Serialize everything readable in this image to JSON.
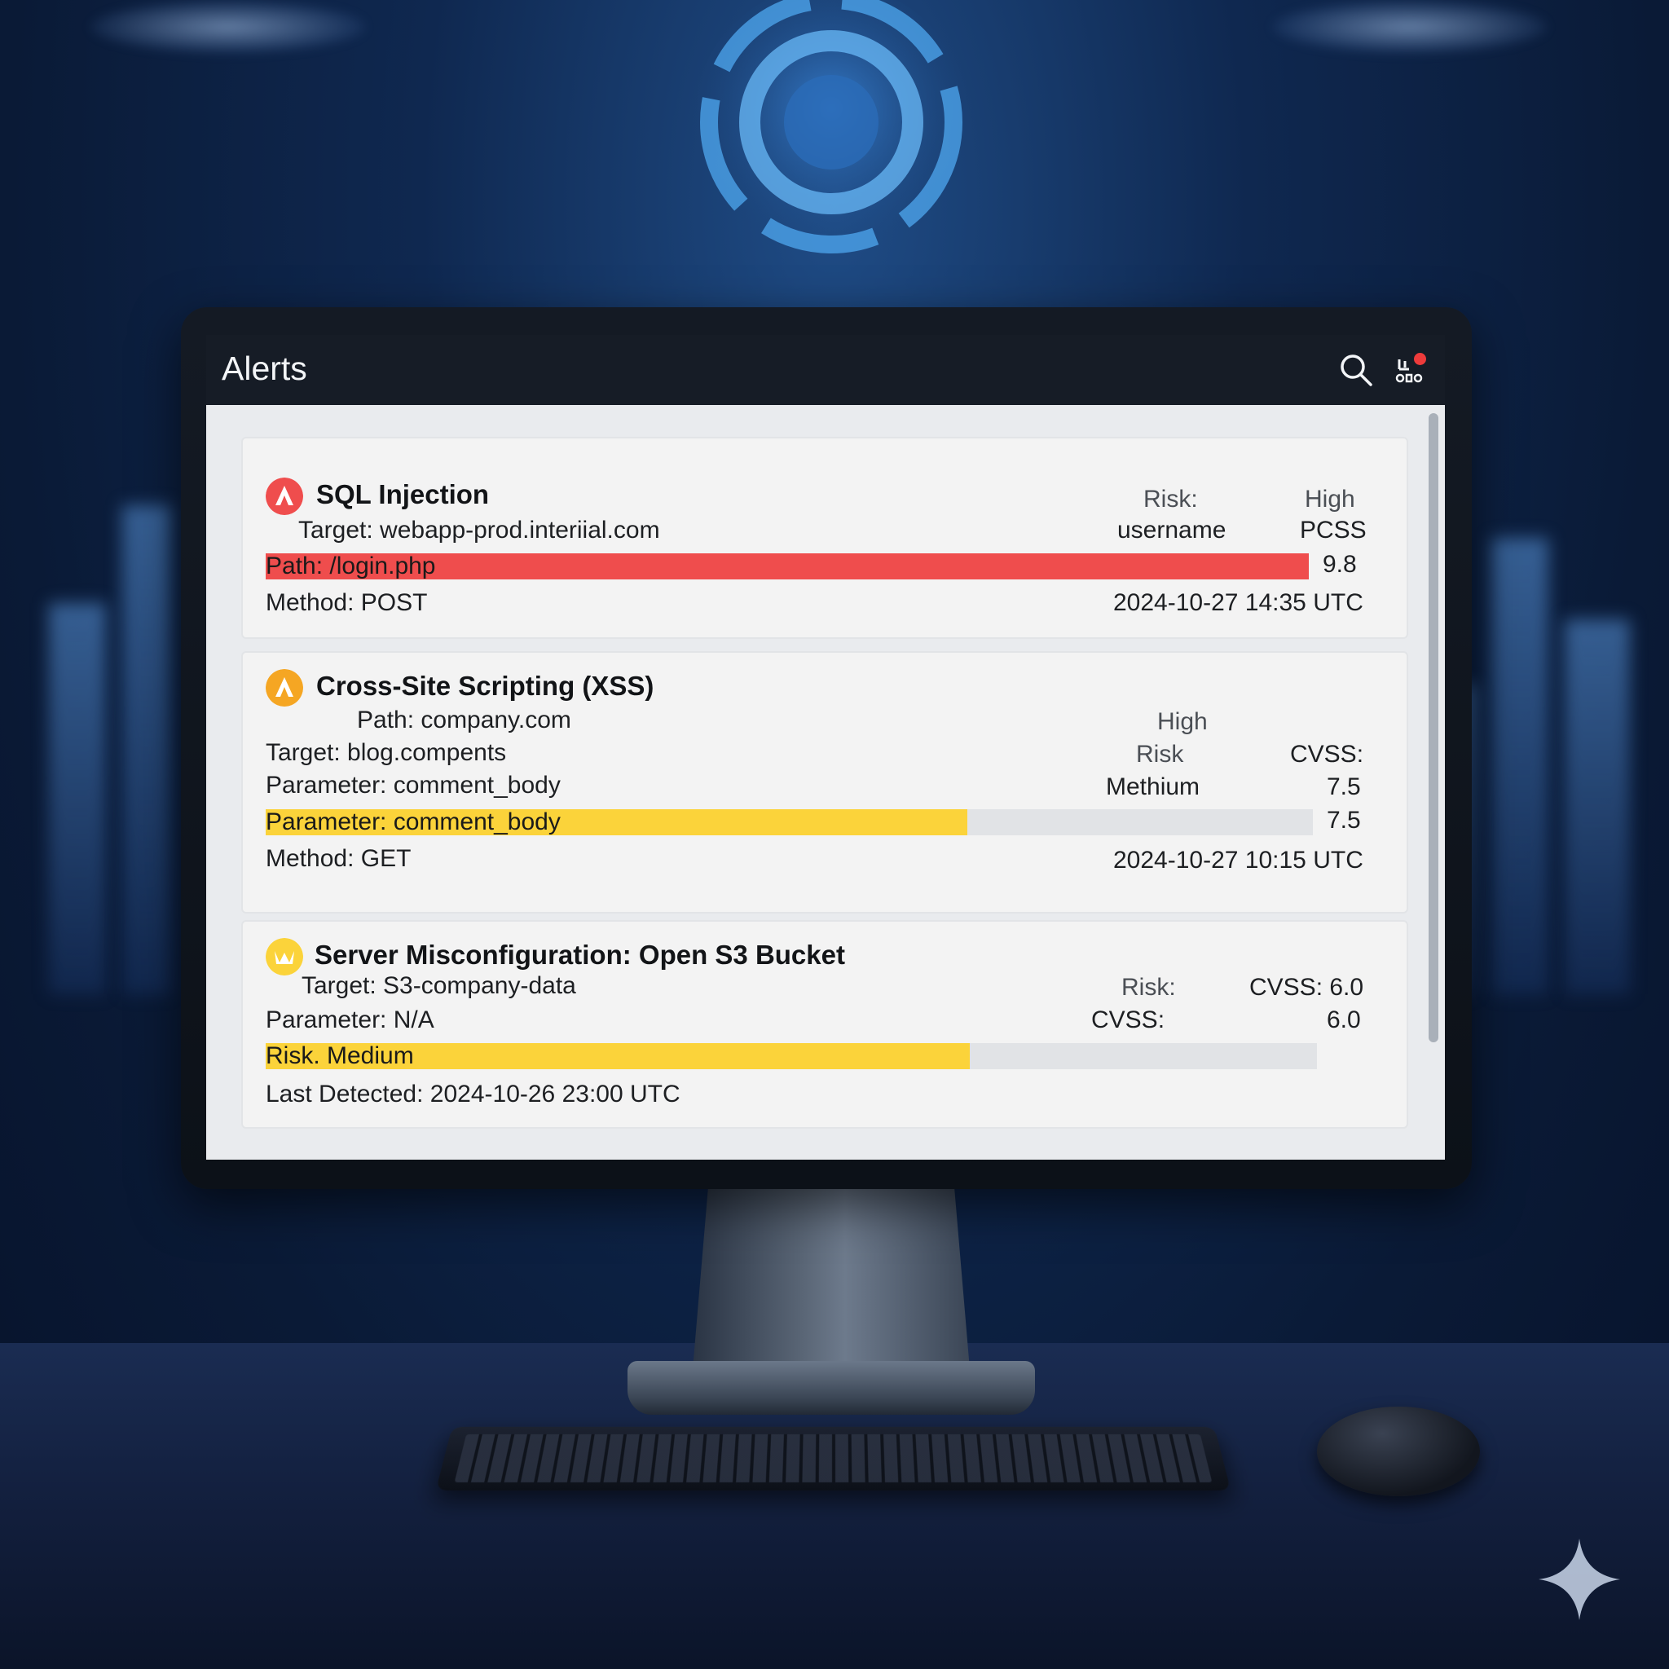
{
  "window": {
    "title": "Alerts"
  },
  "colors": {
    "critical": "#ef4d4d",
    "warning": "#fbd33a",
    "titlebar": "#161c26",
    "notification_dot": "#ee3b3b"
  },
  "icons": {
    "search": "search-icon",
    "notifications": "notification-bell-icon",
    "severity_critical": "alert-triangle-icon",
    "severity_high": "alert-triangle-icon",
    "severity_medium": "warning-crown-icon"
  },
  "alerts": [
    {
      "title": "SQL Injection",
      "target": "Target: webapp-prod.interiial.com",
      "bar_label": "Path: /login.php",
      "bar_fill_fraction": 1.0,
      "bar_score": "9.8",
      "method": "Method: POST",
      "risk_label": "Risk:",
      "risk_value": "High",
      "param_value": "username",
      "score_label": "PCSS",
      "timestamp": "2024-10-27 14:35 UTC"
    },
    {
      "title": "Cross-Site Scripting (XSS)",
      "path": "Path: company.com",
      "target": "Target: blog.compents",
      "parameter": "Parameter: comment_body",
      "bar_label": "Parameter: comment_body",
      "bar_fill_fraction": 0.67,
      "bar_score": "7.5",
      "method": "Method: GET",
      "risk_top": "High",
      "risk_label": "Risk",
      "risk_value": "Methium",
      "cvss_label": "CVSS:",
      "cvss_value": "7.5",
      "timestamp": "2024-10-27 10:15 UTC"
    },
    {
      "title": "Server Misconfiguration: Open S3 Bucket",
      "target": "Target: S3-company-data",
      "parameter": "Parameter: N/A",
      "bar_label": "Risk. Medium",
      "bar_fill_fraction": 0.67,
      "risk_label": "Risk:",
      "cvss_label": "CVSS:",
      "cvss_inline": "CVSS: 6.0",
      "cvss_value": "6.0",
      "last_detected": "Last Detected: 2024-10-26 23:00 UTC"
    }
  ]
}
